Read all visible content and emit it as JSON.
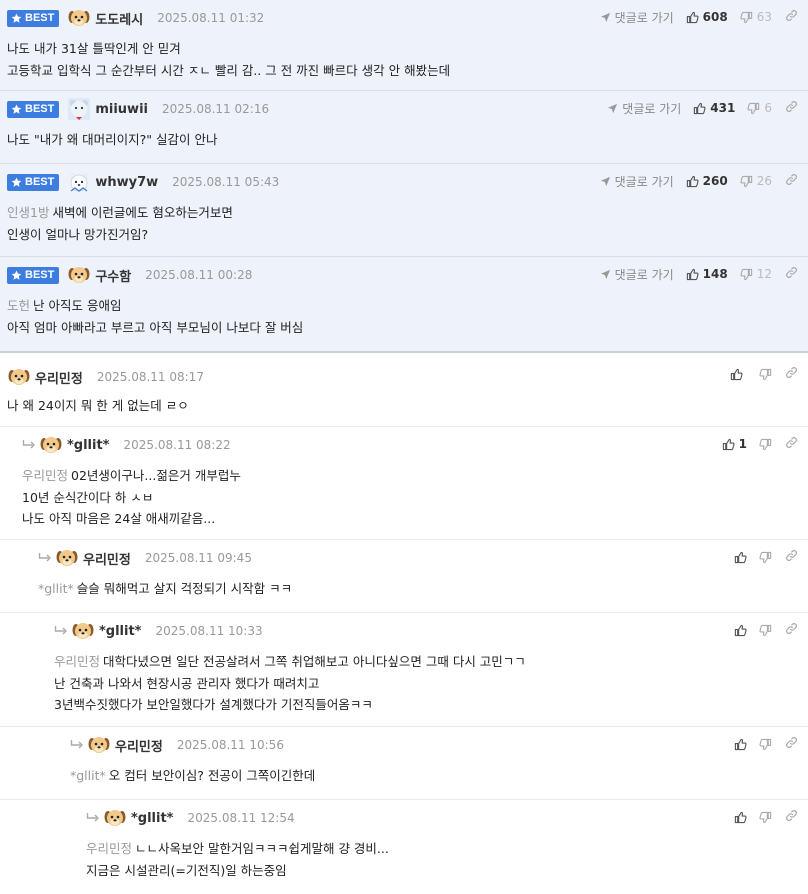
{
  "best_badge": "BEST",
  "goto_label": "댓글로 가기",
  "comments": [
    {
      "best": true,
      "nick": "도도레시",
      "avatar": "puppy-avatar",
      "date": "2025.08.11 01:32",
      "up": "608",
      "down": "63",
      "lines": [
        {
          "mention": "",
          "text": "나도 내가 31살 틀딱인게 안 믿겨"
        },
        {
          "mention": "",
          "text": "고등학교 입학식 그 순간부터 시간 ㅈㄴ 빨리 감.. 그 전 까진 빠르다 생각 안 해봤는데"
        }
      ]
    },
    {
      "best": true,
      "nick": "miiuwii",
      "avatar": "bear-avatar",
      "date": "2025.08.11 02:16",
      "up": "431",
      "down": "6",
      "lines": [
        {
          "mention": "",
          "text": "나도 \"내가 왜 대머리이지?\" 실감이 안나"
        }
      ]
    },
    {
      "best": true,
      "nick": "whwy7w",
      "avatar": "white-dog-avatar",
      "date": "2025.08.11 05:43",
      "up": "260",
      "down": "26",
      "lines": [
        {
          "mention": "인생1방",
          "text": "새벽에 이런글에도 혐오하는거보면"
        },
        {
          "mention": "",
          "text": "인생이 얼마나 망가진거임?"
        }
      ]
    },
    {
      "best": true,
      "nick": "구수함",
      "avatar": "puppy-avatar",
      "date": "2025.08.11 00:28",
      "up": "148",
      "down": "12",
      "lines": [
        {
          "mention": "도헌",
          "text": "난 아직도 응애임"
        },
        {
          "mention": "",
          "text": "아직 엄마 아빠라고 부르고 아직 부모님이 나보다 잘 버심"
        }
      ]
    },
    {
      "best": false,
      "nick": "우리민정",
      "avatar": "puppy-avatar",
      "date": "2025.08.11 08:17",
      "up": "",
      "down": "",
      "lines": [
        {
          "mention": "",
          "text": "나 왜 24이지 뭐 한 게 없는데 ㄹㅇ"
        }
      ]
    },
    {
      "best": false,
      "nick": "*gllit*",
      "avatar": "puppy-avatar",
      "date": "2025.08.11 08:22",
      "up": "1",
      "down": "",
      "lines": [
        {
          "mention": "우리민정",
          "text": "02년생이구나...젊은거 개부럽누"
        },
        {
          "mention": "",
          "text": "10년 순식간이다 하 ㅅㅂ"
        },
        {
          "mention": "",
          "text": "나도 아직 마음은 24살 애새끼같음..."
        }
      ]
    },
    {
      "best": false,
      "nick": "우리민정",
      "avatar": "puppy-avatar",
      "date": "2025.08.11 09:45",
      "up": "",
      "down": "",
      "lines": [
        {
          "mention": "*gllit*",
          "text": "슬슬 뭐해먹고 살지 걱정되기 시작함 ㅋㅋ"
        }
      ]
    },
    {
      "best": false,
      "nick": "*gllit*",
      "avatar": "puppy-avatar",
      "date": "2025.08.11 10:33",
      "up": "",
      "down": "",
      "lines": [
        {
          "mention": "우리민정",
          "text": "대학다녔으면 일단 전공살려서 그쪽 취업해보고 아니다싶으면 그때 다시 고민ㄱㄱ"
        },
        {
          "mention": "",
          "text": "난 건축과 나와서 현장시공 관리자 했다가 때려치고"
        },
        {
          "mention": "",
          "text": "3년백수짓했다가 보안일했다가 설계했다가 기전직들어옴ㅋㅋ"
        }
      ]
    },
    {
      "best": false,
      "nick": "우리민정",
      "avatar": "puppy-avatar",
      "date": "2025.08.11 10:56",
      "up": "",
      "down": "",
      "lines": [
        {
          "mention": "*gllit*",
          "text": "오 컴터 보안이심? 전공이 그쪽이긴한데"
        }
      ]
    },
    {
      "best": false,
      "nick": "*gllit*",
      "avatar": "puppy-avatar",
      "date": "2025.08.11 12:54",
      "up": "",
      "down": "",
      "lines": [
        {
          "mention": "우리민정",
          "text": "ㄴㄴ사옥보안 말한거임ㅋㅋㅋ쉽게말해 걍 경비..."
        },
        {
          "mention": "",
          "text": "지금은 시설관리(=기전직)일 하는중임"
        }
      ]
    }
  ]
}
